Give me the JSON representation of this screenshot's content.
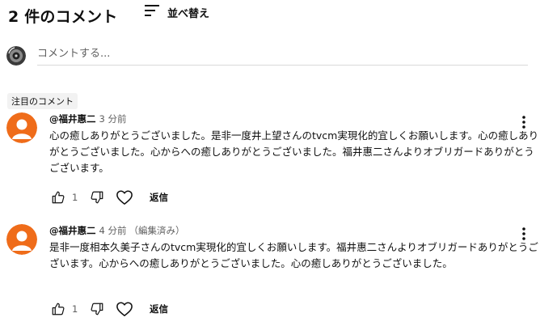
{
  "header": {
    "count_label": "2 件のコメント",
    "sort_label": "並べ替え",
    "sort_icon": "sort-lines-icon"
  },
  "composer": {
    "placeholder": "コメントする..."
  },
  "chip": {
    "label": "注目のコメント"
  },
  "comments": [
    {
      "author": "@福井惠二",
      "time": "3 分前",
      "edited": "",
      "text": "心の癒しありがとうございました。是非一度井上望さんのtvcm実現化的宜しくお願いします。心の癒しありがとうございました。心からへの癒しありがとうございました。福井惠二さんよりオブリガードありがとうございます。",
      "likes": "1",
      "reply_label": "返信"
    },
    {
      "author": "@福井惠二",
      "time": "4 分前",
      "edited": "（編集済み）",
      "text": "是非一度相本久美子さんのtvcm実現化的宜しくお願いします。福井惠二さんよりオブリガードありがとうございます。心からへの癒しありがとうございました。心の癒しありがとうございました。",
      "likes": "1",
      "reply_label": "返信"
    }
  ],
  "colors": {
    "avatar_orange": "#ef6c1a",
    "text_primary": "#0f0f0f",
    "text_secondary": "#606060",
    "divider": "#d9d9d9",
    "chip_bg": "#f2f2f2"
  }
}
